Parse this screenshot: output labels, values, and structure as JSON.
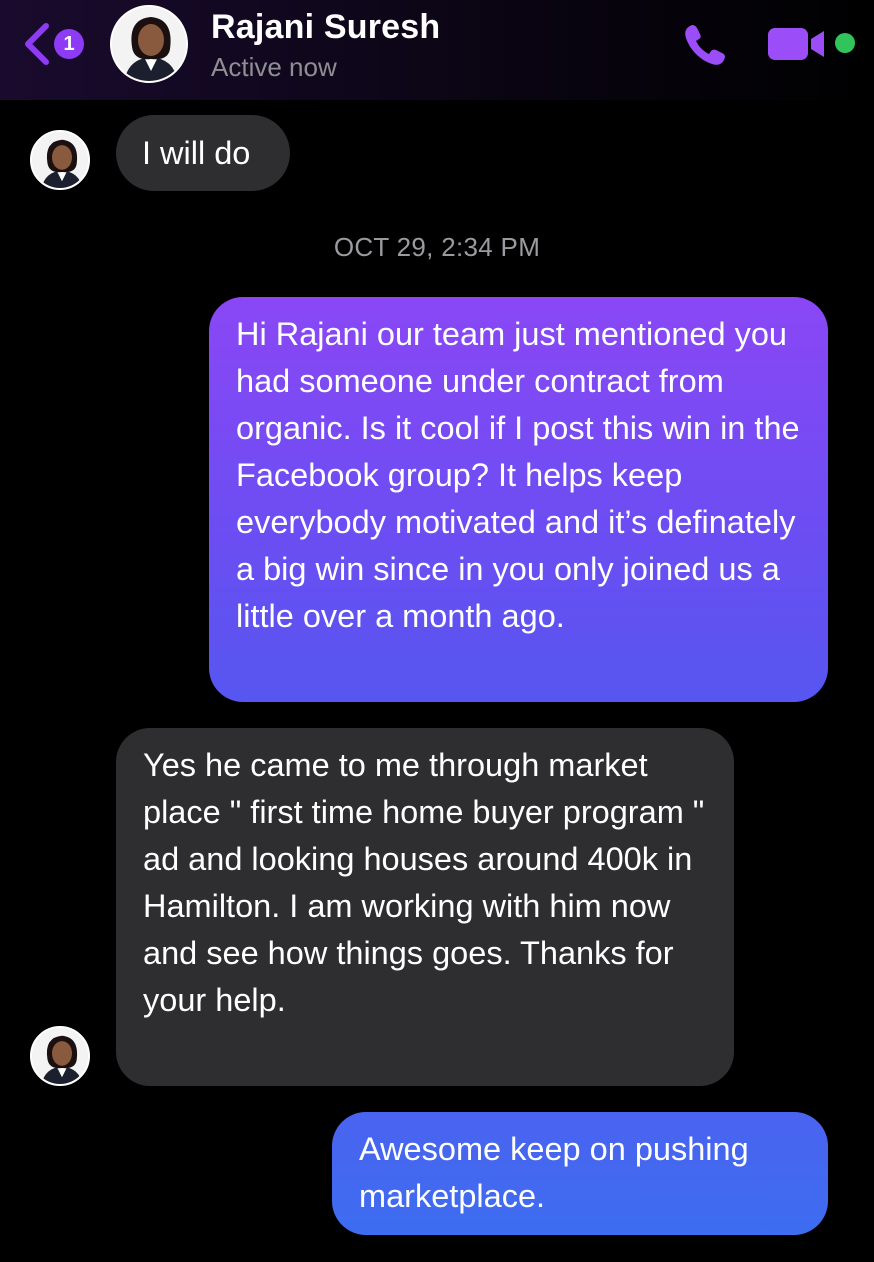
{
  "header": {
    "back_badge_count": "1",
    "contact_name": "Rajani Suresh",
    "status": "Active now",
    "icons": [
      "back-chevron-icon",
      "phone-icon",
      "video-camera-icon",
      "online-status-dot"
    ],
    "accent_color": "#8e3bf6",
    "online_color": "#31c45a"
  },
  "conversation": {
    "timestamp": "OCT 29, 2:34 PM",
    "messages": [
      {
        "sender": "Rajani Suresh",
        "direction": "incoming",
        "text": "I will do"
      },
      {
        "sender": "me",
        "direction": "outgoing",
        "text": "Hi Rajani our team just mentioned you had someone under contract from organic. Is it cool if I post this win in the Facebook group? It helps keep everybody motivated and it’s definately a big win since in you only joined us a little over a month ago."
      },
      {
        "sender": "Rajani Suresh",
        "direction": "incoming",
        "text": "Yes he came to me through market place \" first time home buyer program \" ad and looking houses around  400k in Hamilton. I am working with him now  and see how things goes. Thanks for your help."
      },
      {
        "sender": "me",
        "direction": "outgoing",
        "text": "Awesome keep on pushing marketplace."
      }
    ]
  },
  "colors": {
    "incoming_bubble": "#2e2e30",
    "outgoing_bubble_top": "#8a47f5",
    "outgoing_bubble_bottom": "#3d6df0"
  }
}
